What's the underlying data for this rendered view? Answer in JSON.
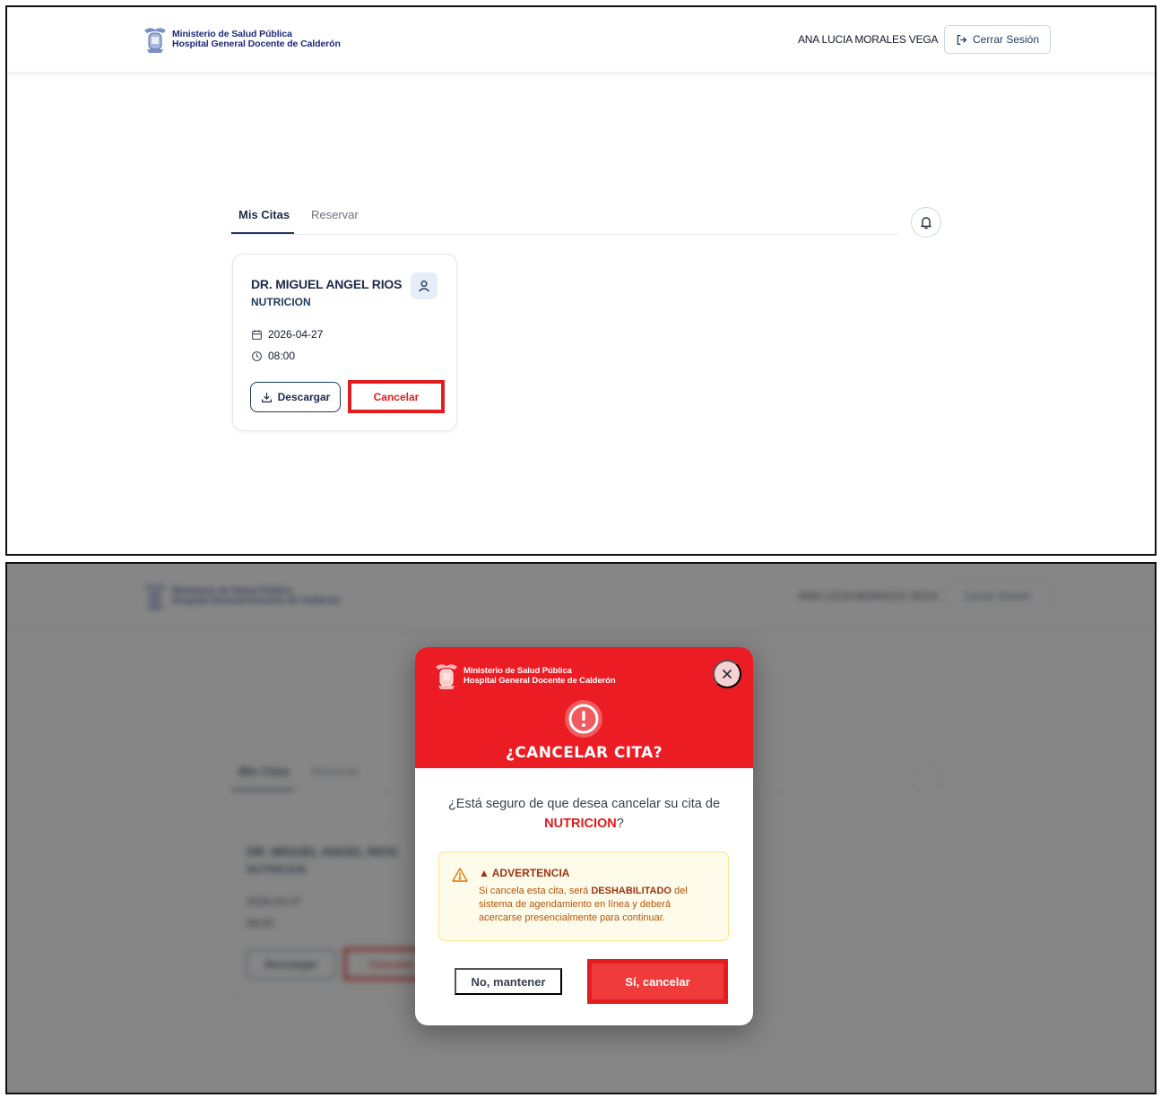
{
  "header": {
    "ministry": "Ministerio de Salud Pública",
    "hospital": "Hospital General Docente de Calderón",
    "user_name": "ANA LUCIA MORALES VEGA",
    "logout_label": "Cerrar Sesión"
  },
  "tabs": [
    {
      "label": "Mis Citas",
      "active": true
    },
    {
      "label": "Reservar",
      "active": false
    }
  ],
  "appointment": {
    "doctor": "DR. MIGUEL ANGEL RIOS",
    "specialty": "NUTRICION",
    "date": "2026-04-27",
    "time": "08:00",
    "download_label": "Descargar",
    "cancel_label": "Cancelar"
  },
  "modal": {
    "ministry": "Ministerio de Salud Pública",
    "hospital": "Hospital General Docente de Calderón",
    "title": "¿CANCELAR CITA?",
    "question_prefix": "¿Está seguro de que desea cancelar su cita de",
    "question_specialty": "NUTRICION",
    "question_suffix": "?",
    "warning_title": "▲ ADVERTENCIA",
    "warning_text_1": "Si cancela esta cita, será ",
    "warning_bold": "DESHABILITADO",
    "warning_text_2": " del sistema de agendamiento en línea y deberá acercarse presencialmente para continuar.",
    "keep_label": "No, mantener",
    "confirm_label": "Sí, cancelar"
  },
  "colors": {
    "brand_navy": "#1e2a78",
    "danger_red": "#ec1c24",
    "highlight_red": "#e11d1d",
    "warning_bg": "#fffbea"
  },
  "icons": [
    "crest-logo",
    "logout-icon",
    "bell-icon",
    "user-icon",
    "calendar-icon",
    "clock-icon",
    "download-icon",
    "close-icon",
    "alert-circle-icon",
    "warning-triangle-icon"
  ]
}
